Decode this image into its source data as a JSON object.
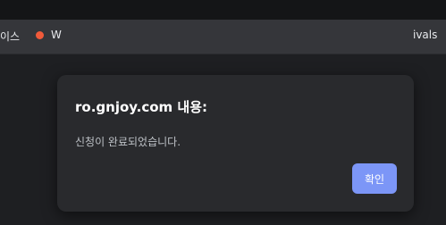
{
  "bookmarks_bar": {
    "left_text": "이스",
    "w_text": "W",
    "right_text": "ivals"
  },
  "dialog": {
    "title": "ro.gnjoy.com 내용:",
    "message": "신청이 완료되었습니다.",
    "ok_label": "확인"
  },
  "colors": {
    "page_bg": "#1e1f22",
    "dialog_bg": "#292a2d",
    "ok_button": "#7c96f7",
    "bookmark_dot": "#f05a3a"
  }
}
